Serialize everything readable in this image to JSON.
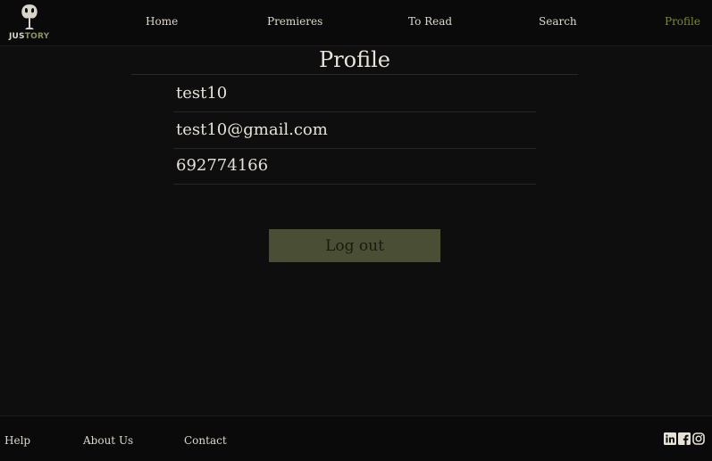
{
  "logo": {
    "text_main": "JUS",
    "text_accent": "TORY",
    "icon": "book-tree-logo"
  },
  "nav": {
    "items": [
      {
        "label": "Home"
      },
      {
        "label": "Premieres"
      },
      {
        "label": "To Read"
      },
      {
        "label": "Search"
      },
      {
        "label": "Profile",
        "active": true
      }
    ]
  },
  "profile": {
    "title": "Profile",
    "username": "test10",
    "email": "test10@gmail.com",
    "phone": "692774166",
    "logout_label": "Log out"
  },
  "footer": {
    "links": [
      {
        "label": "Help"
      },
      {
        "label": "About Us"
      },
      {
        "label": "Contact"
      }
    ],
    "social_icons": [
      "linkedin-icon",
      "facebook-icon",
      "instagram-icon"
    ]
  },
  "colors": {
    "background": "#0e0e0e",
    "accent": "#7a8a2e",
    "button": "#4a4e34"
  }
}
